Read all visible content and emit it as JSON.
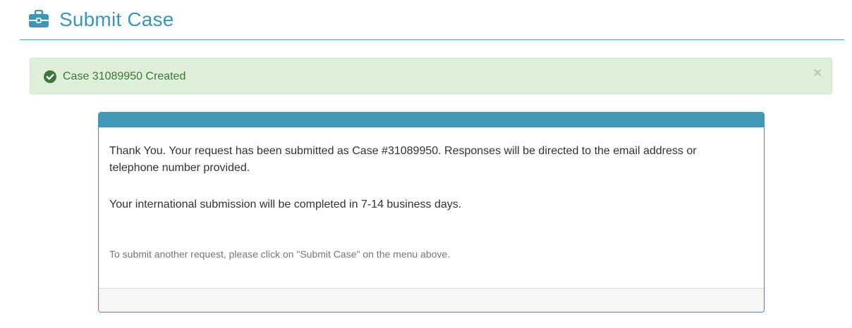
{
  "header": {
    "title": "Submit Case",
    "icon": "briefcase-icon"
  },
  "alert": {
    "icon": "check-circle-icon",
    "message": "Case 31089950 Created",
    "close_label": "×"
  },
  "panel": {
    "message": "Thank You.  Your request has been submitted as Case #31089950. Responses will be directed to the email address or telephone number provided.",
    "timeline": "Your international submission will be completed in 7-14 business days.",
    "hint": "To submit another request, please click on \"Submit Case\" on the menu above."
  },
  "colors": {
    "accent": "#3f96b4",
    "success_bg": "#dff0d8",
    "success_text": "#3c763d"
  }
}
